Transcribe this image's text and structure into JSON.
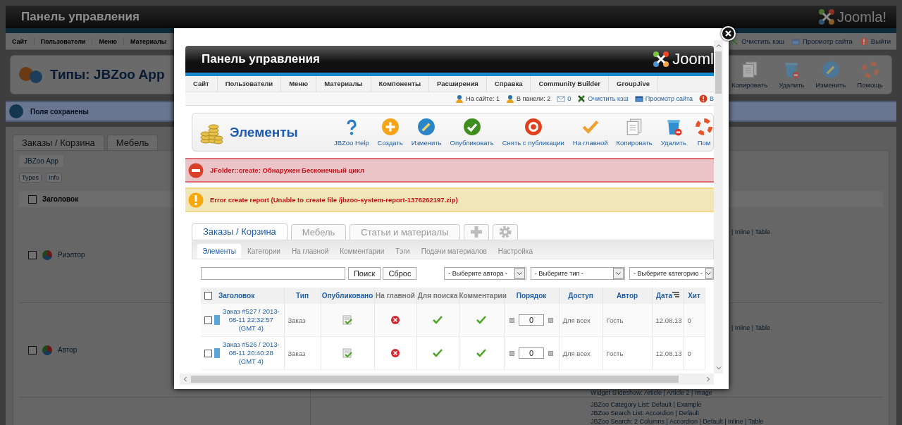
{
  "background": {
    "header": {
      "title": "Панель управления",
      "logo": "Joomla!"
    },
    "menu": [
      "Сайт",
      "Пользователи",
      "Меню",
      "Материалы"
    ],
    "status": [
      {
        "kind": "cache",
        "label": "Очистить кэш"
      },
      {
        "kind": "preview",
        "label": "Просмотр сайта"
      },
      {
        "kind": "logout",
        "label": "Выйти"
      }
    ],
    "toolbar": {
      "title": "Типы: JBZoo App",
      "buttons": [
        {
          "kind": "copy",
          "label": "Копировать"
        },
        {
          "kind": "delete",
          "label": "Удалить"
        },
        {
          "kind": "edit",
          "label": "Изменить"
        },
        {
          "kind": "help",
          "label": "Помощь"
        }
      ]
    },
    "message": "Поля сохранены",
    "tabs": [
      "Заказы / Корзина",
      "Мебель"
    ],
    "subtab": "JBZoo App",
    "buttons": [
      "Types",
      "Info"
    ],
    "table": {
      "column": "Заголовок",
      "checked": false,
      "rows": [
        {
          "title": "Риэлтор",
          "checked": false,
          "layouts": [
            "| Inline | Table"
          ]
        },
        {
          "title": "Автор",
          "checked": false,
          "layouts": [
            "| Inline | Table",
            "Widget Slideshow: Article | Article 2 | Image"
          ]
        },
        {
          "layouts": [
            "JBZoo Category List: Default | Example",
            "JBZoo Search List: Accordion | Default",
            "JBZoo Search: 2 Columns | Accordion | Default | Inline | Table"
          ]
        }
      ]
    }
  },
  "modal": {
    "header": {
      "title": "Панель управления",
      "logo": "Jooml"
    },
    "menu": [
      "Сайт",
      "Пользователи",
      "Меню",
      "Материалы",
      "Компоненты",
      "Расширения",
      "Справка",
      "Community Builder",
      "GroupJive"
    ],
    "status": [
      {
        "kind": "users",
        "label": "На сайте: 1"
      },
      {
        "kind": "users",
        "label": "В панели: 2"
      },
      {
        "kind": "messages",
        "label": "0"
      },
      {
        "kind": "cache",
        "label": "Очистить кэш"
      },
      {
        "kind": "preview",
        "label": "Просмотр сайта"
      },
      {
        "kind": "logout",
        "label": "В"
      }
    ],
    "toolbar": {
      "title": "Элементы",
      "buttons": [
        {
          "kind": "question",
          "label": "JBZoo Help"
        },
        {
          "kind": "create",
          "label": "Создать"
        },
        {
          "kind": "edit",
          "label": "Изменить"
        },
        {
          "kind": "publish",
          "label": "Опубликовать"
        },
        {
          "kind": "unpublish",
          "label": "Снять с публикации"
        },
        {
          "kind": "featured",
          "label": "На главной"
        },
        {
          "kind": "copy",
          "label": "Копировать"
        },
        {
          "kind": "delete",
          "label": "Удалить"
        },
        {
          "kind": "help",
          "label": "Пом"
        }
      ]
    },
    "messages": [
      {
        "kind": "error",
        "text": "JFolder::create: Обнаружен Бесконечный цикл"
      },
      {
        "kind": "warning",
        "text": "Error create report (Unable to create file /jbzoo-system-report-1376262197.zip)"
      }
    ],
    "tabs": [
      {
        "label": "Заказы / Корзина",
        "selected": true
      },
      {
        "label": "Мебель",
        "selected": false
      },
      {
        "label": "Статьи и материалы",
        "selected": false
      }
    ],
    "icon_tabs": [
      {
        "kind": "add"
      },
      {
        "kind": "settings"
      }
    ],
    "subtabs": [
      {
        "label": "Элементы",
        "selected": true
      },
      {
        "label": "Категории",
        "selected": false
      },
      {
        "label": "На главной",
        "selected": false
      },
      {
        "label": "Комментарии",
        "selected": false
      },
      {
        "label": "Тэги",
        "selected": false
      },
      {
        "label": "Подачи материалов",
        "selected": false
      },
      {
        "label": "Настройка",
        "selected": false
      }
    ],
    "filter": {
      "buttons": [
        "Поиск",
        "Сброс"
      ],
      "selects": [
        "- Выберите автора -",
        "- Выберите тип -",
        "- Выберите категорию -"
      ]
    },
    "table": {
      "checked": false,
      "columns": [
        {
          "label": "Заголовок",
          "sortable": true,
          "sorted": false
        },
        {
          "label": "Тип",
          "sortable": true,
          "sorted": false
        },
        {
          "label": "Опубликовано",
          "sortable": true,
          "sorted": false
        },
        {
          "label": "На главной",
          "sortable": false,
          "sorted": false
        },
        {
          "label": "Для поиска",
          "sortable": false,
          "sorted": false
        },
        {
          "label": "Комментарии",
          "sortable": false,
          "sorted": false
        },
        {
          "label": "Порядок",
          "sortable": true,
          "sorted": false
        },
        {
          "label": "Доступ",
          "sortable": true,
          "sorted": false
        },
        {
          "label": "Автор",
          "sortable": true,
          "sorted": false
        },
        {
          "label": "Дата",
          "sortable": true,
          "sorted": true
        },
        {
          "label": "Хит",
          "sortable": true,
          "sorted": false
        }
      ],
      "rows": [
        {
          "checked": false,
          "title": "Заказ #527 / 2013-08-11 22:32:57 (GMT 4)",
          "type": "Заказ",
          "published": true,
          "featured": false,
          "searchable": true,
          "comments": true,
          "order": "0",
          "access": "Для всех",
          "author": "Гость",
          "date": "12.08.13",
          "hits": "0"
        },
        {
          "checked": false,
          "title": "Заказ #526 / 2013-08-11 20:40:28 (GMT 4)",
          "type": "Заказ",
          "published": true,
          "featured": false,
          "searchable": true,
          "comments": true,
          "order": "0",
          "access": "Для всех",
          "author": "Гость",
          "date": "12.08.13",
          "hits": "0"
        }
      ]
    }
  }
}
